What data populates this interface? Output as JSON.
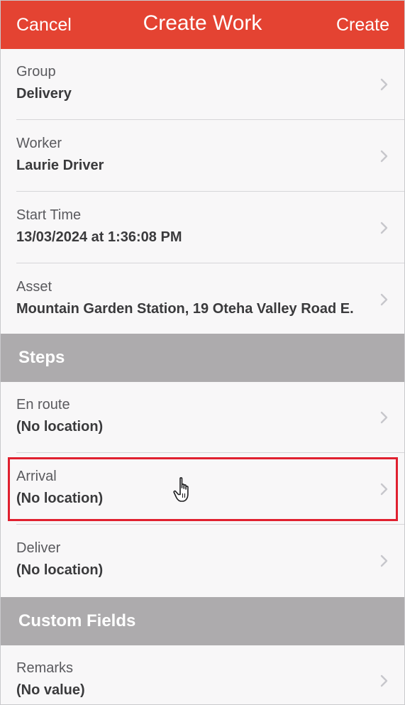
{
  "navbar": {
    "cancel_label": "Cancel",
    "title": "Create Work",
    "create_label": "Create"
  },
  "general": {
    "rows": [
      {
        "label": "Group",
        "value": "Delivery"
      },
      {
        "label": "Worker",
        "value": "Laurie Driver"
      },
      {
        "label": "Start Time",
        "value": "13/03/2024 at 1:36:08 PM"
      },
      {
        "label": "Asset",
        "value": "Mountain Garden Station, 19 Oteha Valley Road E."
      }
    ]
  },
  "steps": {
    "title": "Steps",
    "rows": [
      {
        "label": "En route",
        "value": "(No location)"
      },
      {
        "label": "Arrival",
        "value": "(No location)"
      },
      {
        "label": "Deliver",
        "value": "(No location)"
      }
    ]
  },
  "custom_fields": {
    "title": "Custom Fields",
    "rows": [
      {
        "label": "Remarks",
        "value": "(No value)"
      }
    ]
  },
  "icons": {
    "chevron": "chevron-right-icon",
    "cursor": "hand-pointer-icon"
  },
  "colors": {
    "navbar": "#e44332",
    "section_header": "#adabad",
    "highlight": "#e0202f",
    "background": "#f8f7f8"
  }
}
